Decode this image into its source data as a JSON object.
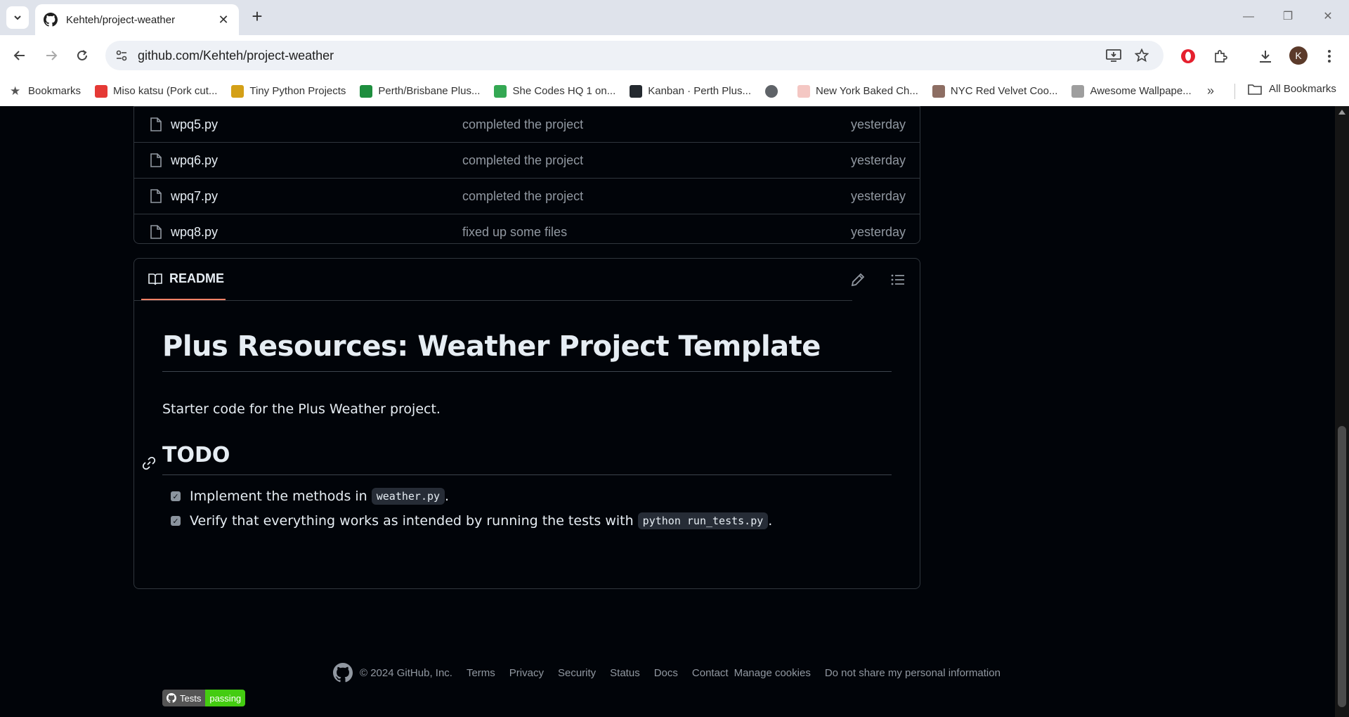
{
  "browser": {
    "tab_title": "Kehteh/project-weather",
    "url": "github.com/Kehteh/project-weather",
    "avatar_letter": "K",
    "bookmarks": [
      {
        "label": "Bookmarks",
        "icon": "star-icon",
        "color": "#555555"
      },
      {
        "label": "Miso katsu (Pork cut...",
        "icon": "site-icon",
        "color": "#e53935"
      },
      {
        "label": "Tiny Python Projects",
        "icon": "person-icon",
        "color": "#d4a017"
      },
      {
        "label": "Perth/Brisbane Plus...",
        "icon": "sheets-icon",
        "color": "#1e8e3e"
      },
      {
        "label": "She Codes HQ 1 on...",
        "icon": "site-icon",
        "color": "#34a853"
      },
      {
        "label": "Kanban · Perth Plus...",
        "icon": "github-icon",
        "color": "#24292f"
      },
      {
        "label": "",
        "icon": "globe-icon",
        "color": "#5f6368"
      },
      {
        "label": "New York Baked Ch...",
        "icon": "site-icon",
        "color": "#f4c7c3"
      },
      {
        "label": "NYC Red Velvet Coo...",
        "icon": "site-icon",
        "color": "#8d6e63"
      },
      {
        "label": "Awesome Wallpape...",
        "icon": "site-icon",
        "color": "#9e9e9e"
      }
    ],
    "all_bookmarks_label": "All Bookmarks"
  },
  "files": [
    {
      "name": "wpq5.py",
      "message": "completed the project",
      "date": "yesterday"
    },
    {
      "name": "wpq6.py",
      "message": "completed the project",
      "date": "yesterday"
    },
    {
      "name": "wpq7.py",
      "message": "completed the project",
      "date": "yesterday"
    },
    {
      "name": "wpq8.py",
      "message": "fixed up some files",
      "date": "yesterday"
    }
  ],
  "readme": {
    "tab_label": "README",
    "h1": "Plus Resources: Weather Project Template",
    "intro": "Starter code for the Plus Weather project.",
    "h2": "TODO",
    "tasks": [
      {
        "text": "Implement the methods in",
        "code": "weather.py",
        "suffix": ".",
        "checked": true
      },
      {
        "text": "Verify that everything works as intended by running the tests with",
        "code": "python run_tests.py",
        "suffix": ".",
        "checked": true
      }
    ],
    "badge_left": "Tests",
    "badge_right": "passing"
  },
  "footer": {
    "copyright": "© 2024 GitHub, Inc.",
    "links": [
      "Terms",
      "Privacy",
      "Security",
      "Status",
      "Docs",
      "Contact",
      "Manage cookies",
      "Do not share my personal information"
    ]
  }
}
